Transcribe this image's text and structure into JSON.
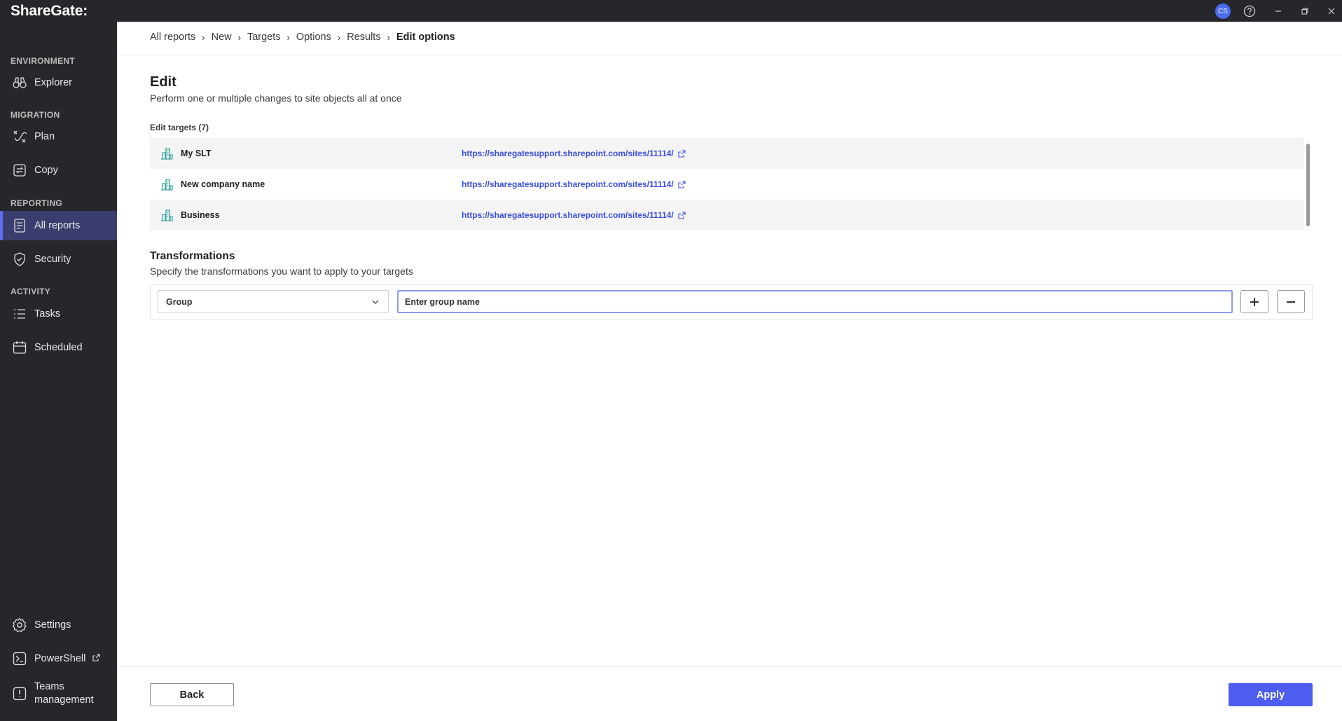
{
  "app": {
    "logo_text": "ShareGate",
    "avatar_initials": "CS",
    "accent_color": "#4d5df0"
  },
  "window_controls": [
    "help-icon",
    "minimize-icon",
    "restore-icon",
    "close-icon"
  ],
  "sidebar": {
    "sections": {
      "environment": "ENVIRONMENT",
      "migration": "MIGRATION",
      "reporting": "REPORTING",
      "activity": "ACTIVITY"
    },
    "items": {
      "explorer": "Explorer",
      "plan": "Plan",
      "copy": "Copy",
      "all_reports": "All reports",
      "security": "Security",
      "tasks": "Tasks",
      "scheduled": "Scheduled",
      "settings": "Settings",
      "powershell": "PowerShell",
      "teams_line1": "Teams",
      "teams_line2": "management"
    },
    "active_item": "All reports"
  },
  "breadcrumb": {
    "items": [
      "All reports",
      "New",
      "Targets",
      "Options",
      "Results"
    ],
    "current": "Edit options"
  },
  "main": {
    "title": "Edit",
    "subtitle": "Perform one or multiple changes to site objects all at once",
    "targets_label": "Edit targets (7)",
    "targets": [
      {
        "name": "My SLT",
        "url": "https://sharegatesupport.sharepoint.com/sites/11114/"
      },
      {
        "name": "New company name",
        "url": "https://sharegatesupport.sharepoint.com/sites/11114/"
      },
      {
        "name": "Business",
        "url": "https://sharegatesupport.sharepoint.com/sites/11114/"
      }
    ],
    "transformations": {
      "title": "Transformations",
      "subtitle": "Specify the transformations you want to apply to your targets",
      "select_value": "Group",
      "input_value": "Enter group name"
    }
  },
  "footer": {
    "back_label": "Back",
    "apply_label": "Apply"
  }
}
